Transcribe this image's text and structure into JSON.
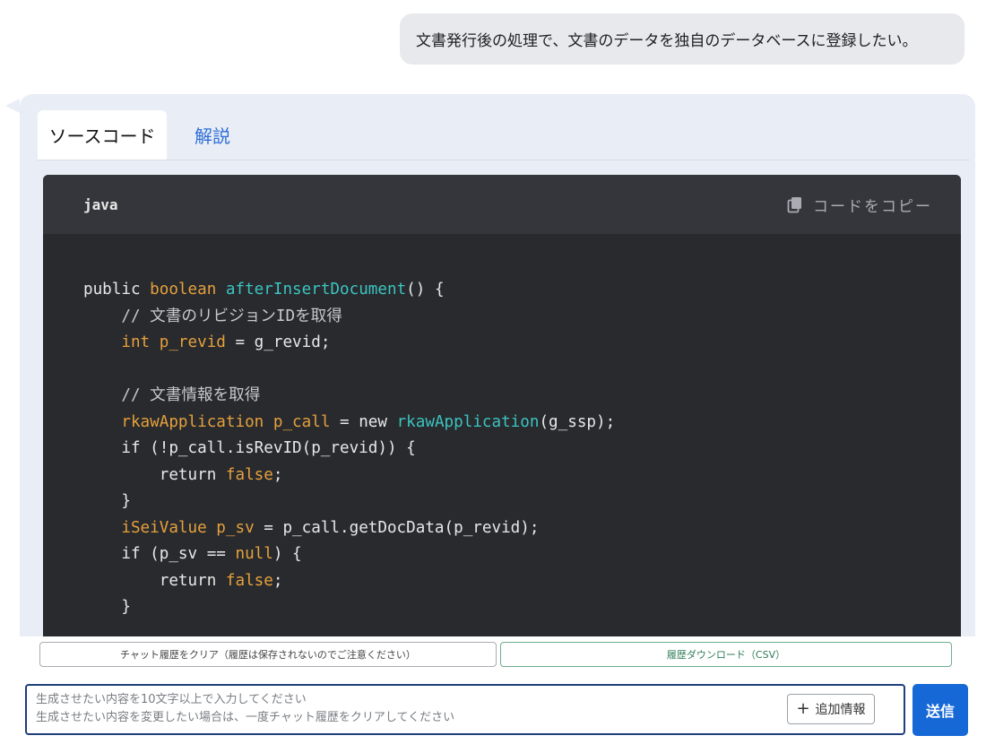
{
  "user_message": "文書発行後の処理で、文書のデータを独自のデータベースに登録したい。",
  "tabs": [
    {
      "label": "ソースコード",
      "active": true
    },
    {
      "label": "解説",
      "active": false
    }
  ],
  "code_block": {
    "language": "java",
    "copy_label": "コードをコピー",
    "lines": [
      [
        {
          "t": "public ",
          "c": "kw"
        },
        {
          "t": "boolean ",
          "c": "type"
        },
        {
          "t": "afterInsertDocument",
          "c": "fn"
        },
        {
          "t": "() {",
          "c": "kw"
        }
      ],
      [
        {
          "t": "    // 文書のリビジョンIDを取得",
          "c": "com"
        }
      ],
      [
        {
          "t": "    ",
          "c": "kw"
        },
        {
          "t": "int p_revid",
          "c": "type"
        },
        {
          "t": " = g_revid;",
          "c": "kw"
        }
      ],
      [
        {
          "t": "",
          "c": "kw"
        }
      ],
      [
        {
          "t": "    // 文書情報を取得",
          "c": "com"
        }
      ],
      [
        {
          "t": "    ",
          "c": "kw"
        },
        {
          "t": "rkawApplication p_call",
          "c": "type"
        },
        {
          "t": " = new ",
          "c": "kw"
        },
        {
          "t": "rkawApplication",
          "c": "fn"
        },
        {
          "t": "(g_ssp);",
          "c": "kw"
        }
      ],
      [
        {
          "t": "    if (!p_call.isRevID(p_revid)) {",
          "c": "kw"
        }
      ],
      [
        {
          "t": "        return ",
          "c": "kw"
        },
        {
          "t": "false",
          "c": "bool"
        },
        {
          "t": ";",
          "c": "kw"
        }
      ],
      [
        {
          "t": "    }",
          "c": "kw"
        }
      ],
      [
        {
          "t": "    ",
          "c": "kw"
        },
        {
          "t": "iSeiValue p_sv",
          "c": "type"
        },
        {
          "t": " = p_call.getDocData(p_revid);",
          "c": "kw"
        }
      ],
      [
        {
          "t": "    if (p_sv == ",
          "c": "kw"
        },
        {
          "t": "null",
          "c": "bool"
        },
        {
          "t": ") {",
          "c": "kw"
        }
      ],
      [
        {
          "t": "        return ",
          "c": "kw"
        },
        {
          "t": "false",
          "c": "bool"
        },
        {
          "t": ";",
          "c": "kw"
        }
      ],
      [
        {
          "t": "    }",
          "c": "kw"
        }
      ]
    ]
  },
  "actions": {
    "clear_label": "チャット履歴をクリア（履歴は保存されないのでご注意ください）",
    "download_label": "履歴ダウンロード（CSV）"
  },
  "input": {
    "placeholder_line1": "生成させたい内容を10文字以上で入力してください",
    "placeholder_line2": "生成させたい内容を変更したい場合は、一度チャット履歴をクリアしてください",
    "add_info_label": "追加情報"
  },
  "send_label": "送信",
  "icons": {
    "copy": "copy-icon",
    "plus": "plus-icon"
  },
  "colors": {
    "accent": "#1668d6",
    "code_bg": "#282a2e",
    "type_color": "#e6a03c",
    "fn_color": "#3cc4c0"
  }
}
